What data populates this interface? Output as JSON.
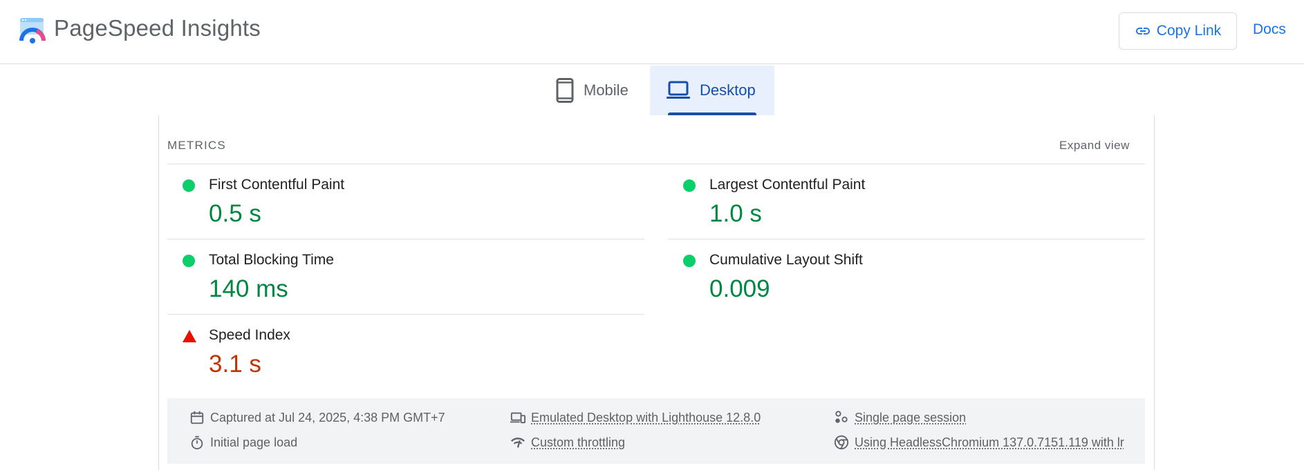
{
  "header": {
    "title": "PageSpeed Insights",
    "copy_link_label": "Copy Link",
    "docs_label": "Docs",
    "logo_icon": "pagespeed-logo-icon"
  },
  "tabs": [
    {
      "label": "Mobile",
      "icon": "phone-icon",
      "selected": false
    },
    {
      "label": "Desktop",
      "icon": "laptop-icon",
      "selected": true
    }
  ],
  "metrics": {
    "heading": "METRICS",
    "expand_label": "Expand view",
    "items": [
      {
        "label": "First Contentful Paint",
        "value": "0.5 s",
        "status": "pass"
      },
      {
        "label": "Largest Contentful Paint",
        "value": "1.0 s",
        "status": "pass"
      },
      {
        "label": "Total Blocking Time",
        "value": "140 ms",
        "status": "pass"
      },
      {
        "label": "Cumulative Layout Shift",
        "value": "0.009",
        "status": "pass"
      },
      {
        "label": "Speed Index",
        "value": "3.1 s",
        "status": "fail"
      }
    ]
  },
  "runtime": {
    "captured": "Captured at Jul 24, 2025, 4:38 PM GMT+7",
    "load": "Initial page load",
    "emulated": "Emulated Desktop with Lighthouse 12.8.0",
    "throttling": "Custom throttling",
    "session": "Single page session",
    "browser": "Using HeadlessChromium 137.0.7151.119 with lr"
  },
  "colors": {
    "accent": "#1a73e8",
    "pass": "#018642",
    "pass_dot": "#0cce6b",
    "fail": "#c33300",
    "fail_marker": "#eb0f00",
    "tab_selected_bg": "#e8f0fe"
  }
}
